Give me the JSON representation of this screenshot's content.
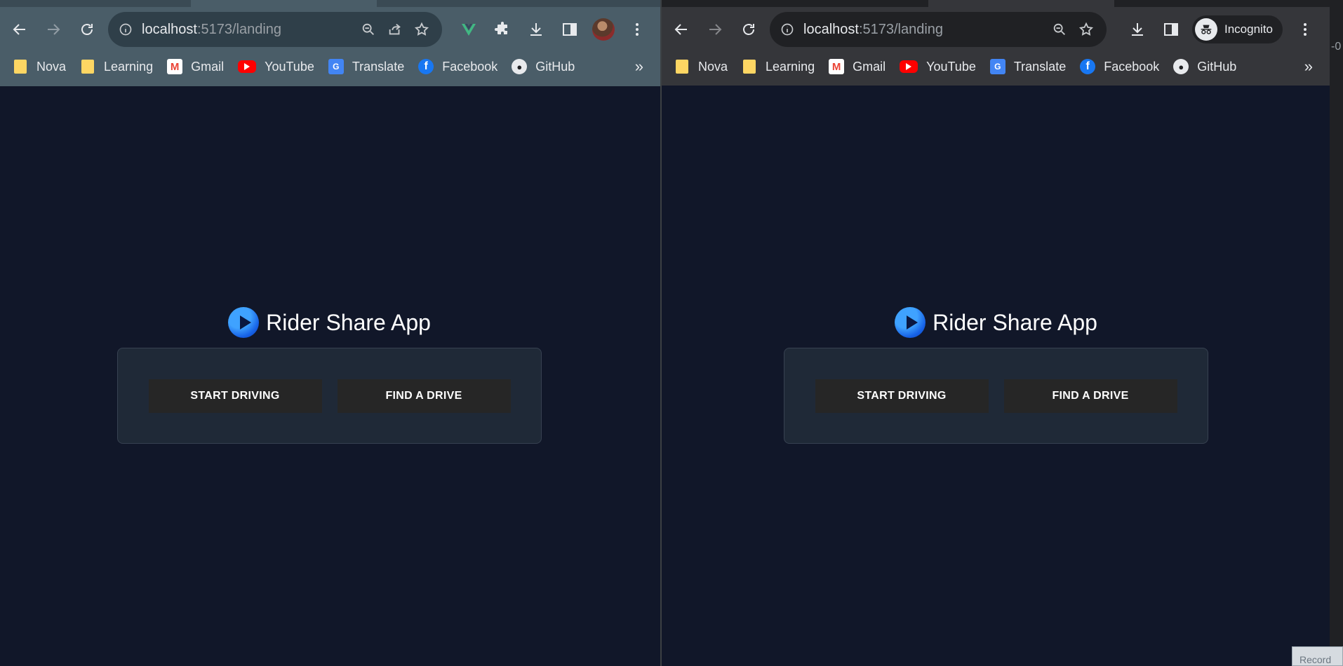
{
  "left_window": {
    "url_host": "localhost",
    "url_rest": ":5173/landing",
    "bookmarks": [
      "Nova",
      "Learning",
      "Gmail",
      "YouTube",
      "Translate",
      "Facebook",
      "GitHub"
    ],
    "bookmarks_more": "»",
    "app": {
      "title": "Rider Share App",
      "start_driving_label": "START DRIVING",
      "find_drive_label": "FIND A DRIVE"
    }
  },
  "right_window": {
    "url_host": "localhost",
    "url_rest": ":5173/landing",
    "incognito_label": "Incognito",
    "bookmarks": [
      "Nova",
      "Learning",
      "Gmail",
      "YouTube",
      "Translate",
      "Facebook",
      "GitHub"
    ],
    "bookmarks_more": "»",
    "app": {
      "title": "Rider Share App",
      "start_driving_label": "START DRIVING",
      "find_drive_label": "FIND A DRIVE"
    }
  },
  "edge_text": "-0",
  "record_label": "Record",
  "colors": {
    "page_background": "#111729",
    "card_background": "#1f2937",
    "button_background": "#262626",
    "left_toolbar": "#4a5d68",
    "right_toolbar": "#35363a",
    "logo_blue": "#1661e6"
  }
}
